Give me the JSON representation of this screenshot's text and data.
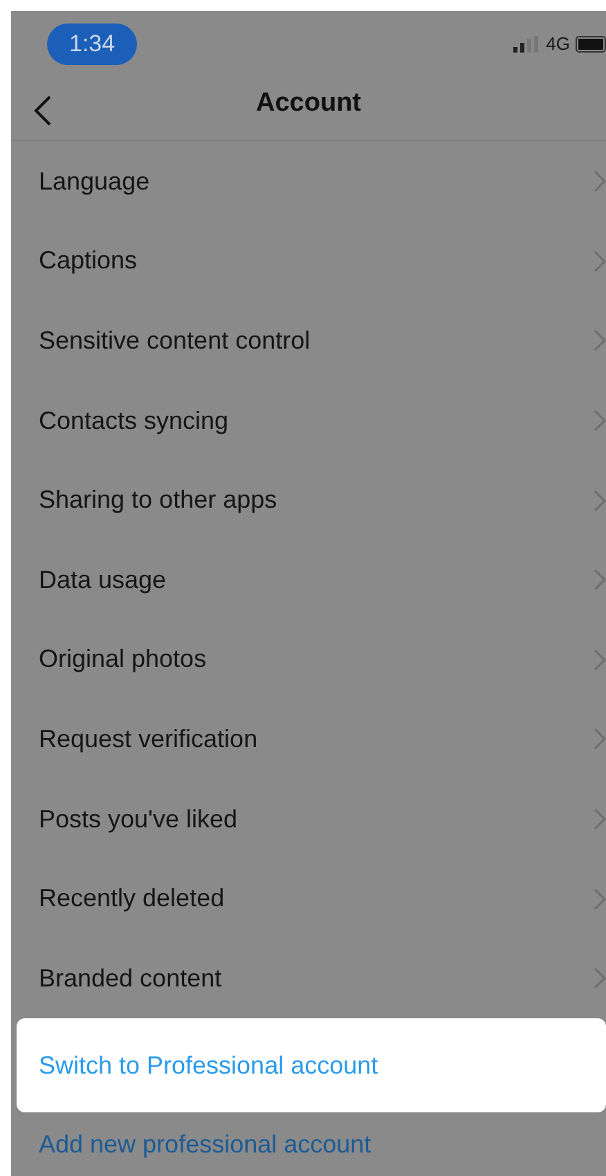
{
  "status_bar": {
    "time": "1:34",
    "network": "4G"
  },
  "header": {
    "title": "Account"
  },
  "settings": [
    {
      "label": "Language"
    },
    {
      "label": "Captions"
    },
    {
      "label": "Sensitive content control"
    },
    {
      "label": "Contacts syncing"
    },
    {
      "label": "Sharing to other apps"
    },
    {
      "label": "Data usage"
    },
    {
      "label": "Original photos"
    },
    {
      "label": "Request verification"
    },
    {
      "label": "Posts you've liked"
    },
    {
      "label": "Recently deleted"
    },
    {
      "label": "Branded content"
    }
  ],
  "actions": [
    {
      "label": "Switch to Professional account",
      "highlighted": true
    },
    {
      "label": "Add new professional account",
      "highlighted": false
    }
  ]
}
